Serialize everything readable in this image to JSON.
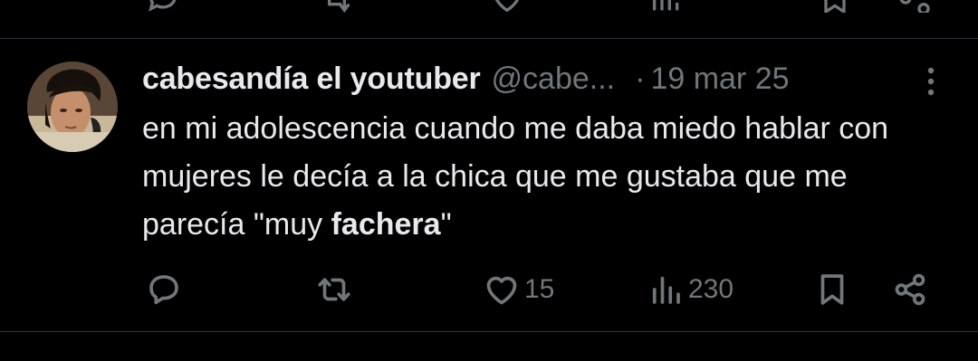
{
  "tweet": {
    "display_name": "cabesandía el youtuber",
    "handle": "@cabe...",
    "separator": "·",
    "date": "19 mar 25",
    "text_before_bold": "en mi adolescencia cuando me daba miedo hablar con mujeres le decía a la chica que me gustaba que me parecía \"muy ",
    "text_bold": "fachera",
    "text_after_bold": "\""
  },
  "actions": {
    "reply_count": "",
    "retweet_count": "",
    "like_count": "15",
    "views_count": "230"
  },
  "icons": {
    "reply": "reply-icon",
    "retweet": "retweet-icon",
    "like": "heart-icon",
    "views": "views-icon",
    "bookmark": "bookmark-icon",
    "share": "share-icon",
    "more": "more-icon"
  },
  "colors": {
    "background": "#000000",
    "primary_text": "#e7e9ea",
    "secondary_text": "#71767b",
    "divider": "#2f3336"
  }
}
